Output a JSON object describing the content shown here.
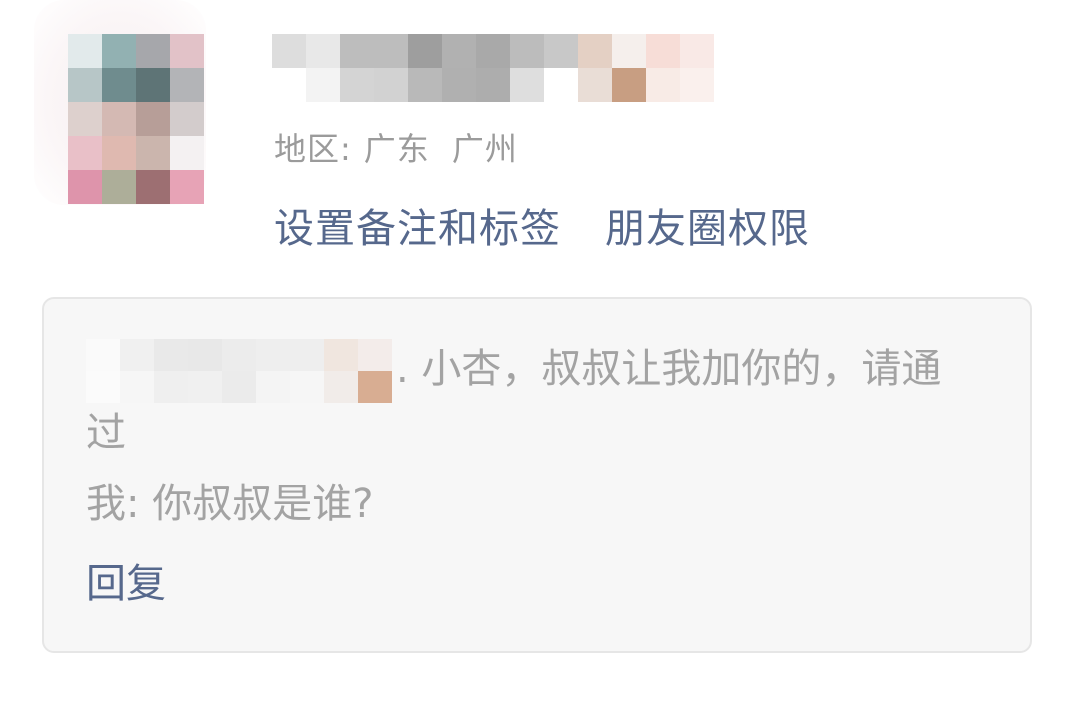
{
  "profile": {
    "avatar_icon": "blurred-avatar",
    "name_display": "obscured",
    "region_label": "地区:",
    "region_province": "广东",
    "region_city": "广州"
  },
  "actions": {
    "set_remark": "设置备注和标签",
    "moments_permission": "朋友圈权限"
  },
  "verification": {
    "sender_message": ". 小杏，叔叔让我加你的，请通过",
    "my_reply": "我: 你叔叔是谁?",
    "reply_button": "回复"
  },
  "colors": {
    "link": "#56688c",
    "muted_text": "#9b9b9b",
    "card_bg": "#f7f7f7",
    "card_border": "#e6e6e6"
  }
}
